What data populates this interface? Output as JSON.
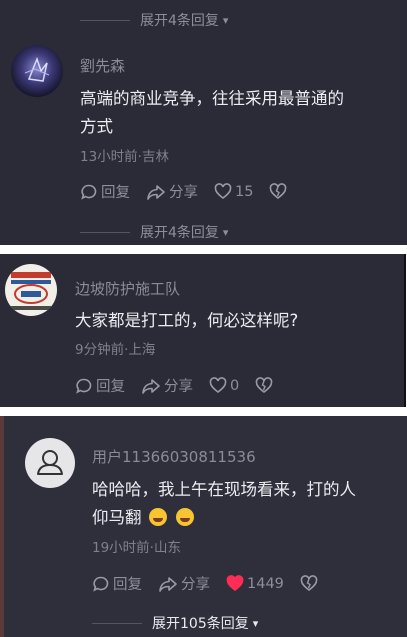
{
  "comments": [
    {
      "expand_top": "展开4条回复",
      "user": "劉先森",
      "text_line1": "高端的商业竞争，往往采用最普通的",
      "text_line2": "方式",
      "meta": "13小时前·吉林",
      "reply_label": "回复",
      "share_label": "分享",
      "like_count": "15",
      "liked": false,
      "expand_bottom": "展开4条回复"
    },
    {
      "user": "边坡防护施工队",
      "text_line1": "大家都是打工的，何必这样呢?",
      "meta": "9分钟前·上海",
      "reply_label": "回复",
      "share_label": "分享",
      "like_count": "0",
      "liked": false
    },
    {
      "user": "用户11366030811536",
      "text_line1": "哈哈哈，我上午在现场看来，打的人",
      "text_line2": "仰马翻",
      "emoji_icon": "rolling-laughing-emoji",
      "meta": "19小时前·山东",
      "reply_label": "回复",
      "share_label": "分享",
      "like_count": "1449",
      "liked": true,
      "expand_bottom": "展开105条回复"
    }
  ],
  "icons": {
    "reply": "comment-bubble-icon",
    "share": "share-arrow-icon",
    "like": "heart-icon",
    "dislike": "broken-heart-icon",
    "expand": "chevron-down-icon",
    "default_avatar": "user-silhouette-icon"
  },
  "colors": {
    "background": "#2b2b37",
    "liked_heart": "#ff2d55",
    "muted_text": "#8e8e99"
  }
}
